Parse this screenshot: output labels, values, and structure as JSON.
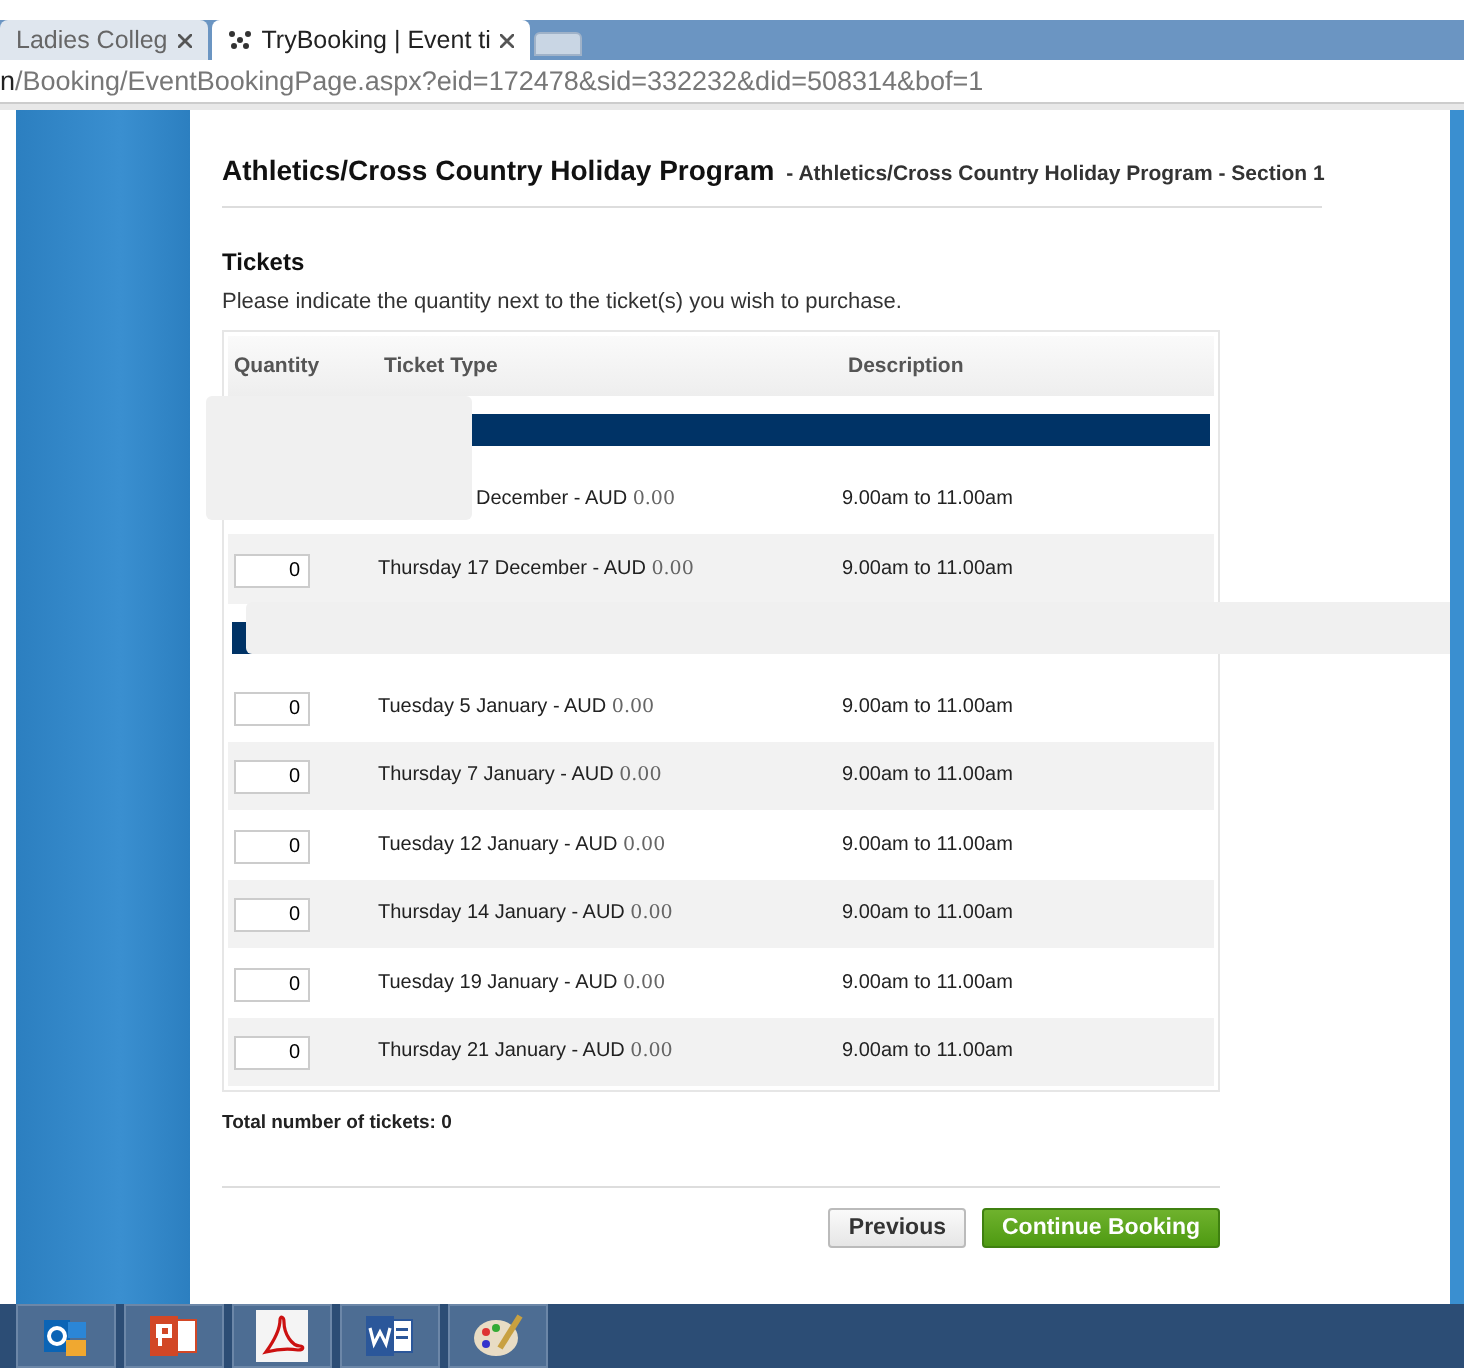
{
  "browser": {
    "tabs": [
      {
        "title": "Ladies Colleg",
        "selected": false
      },
      {
        "title": "TryBooking | Event ti",
        "selected": true
      }
    ],
    "address": {
      "host_part": "n",
      "path": "/Booking/EventBookingPage.aspx?eid=172478&sid=332232&did=508314&bof=1"
    }
  },
  "page": {
    "title": "Athletics/Cross Country Holiday Program",
    "subtitle": "- Athletics/Cross Country Holiday Program - Section 1",
    "section_heading": "Tickets",
    "instructions": "Please indicate the quantity next to the ticket(s) you wish to purchase.",
    "table": {
      "columns": [
        "Quantity",
        "Ticket Type",
        "Description"
      ],
      "rows": [
        {
          "kind": "section"
        },
        {
          "kind": "ticket",
          "ticket": "December - AUD",
          "price": "0.00",
          "description": "9.00am to 11.00am"
        },
        {
          "kind": "ticket",
          "quantity": "0",
          "ticket": "Thursday 17 December - AUD",
          "price": "0.00",
          "description": "9.00am to 11.00am"
        },
        {
          "kind": "section"
        },
        {
          "kind": "ticket",
          "quantity": "0",
          "ticket": "Tuesday 5 January - AUD",
          "price": "0.00",
          "description": "9.00am to 11.00am"
        },
        {
          "kind": "ticket",
          "quantity": "0",
          "ticket": "Thursday 7 January - AUD",
          "price": "0.00",
          "description": "9.00am to 11.00am"
        },
        {
          "kind": "ticket",
          "quantity": "0",
          "ticket": "Tuesday 12 January - AUD",
          "price": "0.00",
          "description": "9.00am to 11.00am"
        },
        {
          "kind": "ticket",
          "quantity": "0",
          "ticket": "Thursday 14 January - AUD",
          "price": "0.00",
          "description": "9.00am to 11.00am"
        },
        {
          "kind": "ticket",
          "quantity": "0",
          "ticket": "Tuesday 19 January - AUD",
          "price": "0.00",
          "description": "9.00am to 11.00am"
        },
        {
          "kind": "ticket",
          "quantity": "0",
          "ticket": "Thursday 21 January - AUD",
          "price": "0.00",
          "description": "9.00am to 11.00am"
        }
      ]
    },
    "total": "Total number of tickets: 0",
    "buttons": [
      {
        "label": "Previous",
        "kind": "secondary"
      },
      {
        "label": "Continue Booking",
        "kind": "primary"
      }
    ]
  },
  "taskbar": {
    "apps": [
      {
        "kind": "mail"
      },
      {
        "kind": "slides"
      },
      {
        "kind": "pdf"
      },
      {
        "kind": "word"
      },
      {
        "kind": "paint"
      }
    ]
  }
}
